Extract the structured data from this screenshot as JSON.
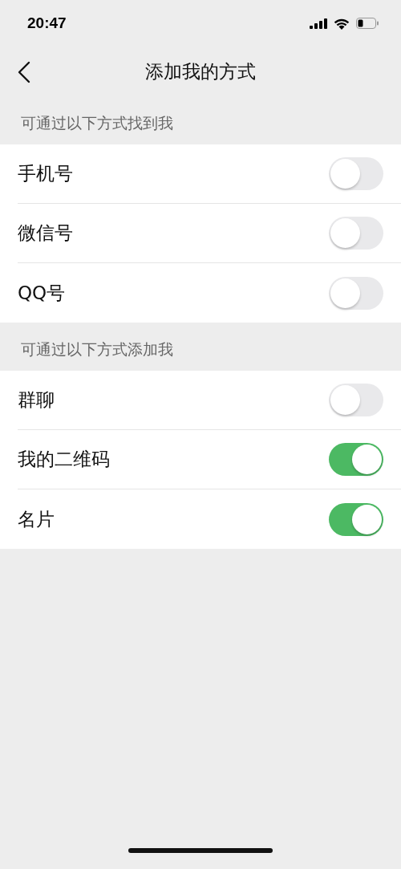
{
  "status_bar": {
    "time": "20:47"
  },
  "nav": {
    "title": "添加我的方式"
  },
  "sections": [
    {
      "header": "可通过以下方式找到我",
      "items": [
        {
          "label": "手机号",
          "on": false
        },
        {
          "label": "微信号",
          "on": false
        },
        {
          "label": "QQ号",
          "on": false
        }
      ]
    },
    {
      "header": "可通过以下方式添加我",
      "items": [
        {
          "label": "群聊",
          "on": false
        },
        {
          "label": "我的二维码",
          "on": true
        },
        {
          "label": "名片",
          "on": true
        }
      ]
    }
  ]
}
